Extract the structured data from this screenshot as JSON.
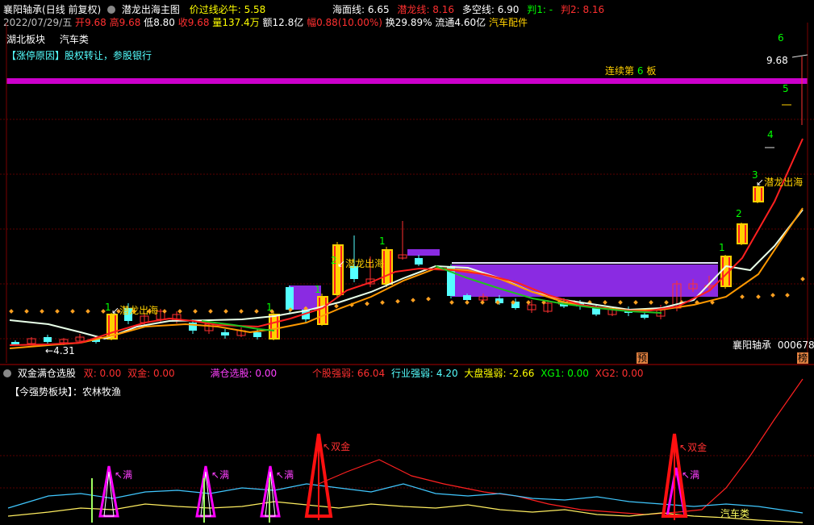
{
  "header": {
    "stock_name": "襄阳轴承",
    "period": "(日线 前复权)",
    "indicator": "潜龙出海主图",
    "price_line_label": "价过线必牛",
    "price_line_value": "5.58",
    "sea_label": "海面线",
    "sea_value": "6.65",
    "dragon_label": "潜龙线",
    "dragon_value": "8.16",
    "bull_label": "多空线",
    "bull_value": "6.90",
    "judge1_label": "判1",
    "judge1_value": "-",
    "judge2_label": "判2",
    "judge2_value": "8.16"
  },
  "quote": {
    "date": "2022/07/29/五",
    "open_label": "开",
    "open": "9.68",
    "high_label": "高",
    "high": "9.68",
    "low_label": "低",
    "low": "8.80",
    "close_label": "收",
    "close": "9.68",
    "vol_label": "量",
    "vol": "137.4万",
    "amt_label": "额",
    "amt": "12.8亿",
    "chg_label": "幅",
    "chg": "0.88(10.00%)",
    "turnover_label": "换",
    "turnover": "29.89%",
    "float_label": "流通",
    "float": "4.60亿",
    "industry": "汽车配件"
  },
  "tags": {
    "region": "湖北板块",
    "sector": "汽车类",
    "reason": "【涨停原因】股权转让，参股银行",
    "streak_prefix": "连续第",
    "streak_num": "6",
    "streak_suffix": "板"
  },
  "price_labels": {
    "max_price": "9.68",
    "min_price": "4.31",
    "stock_label": "襄阳轴承",
    "code": "000678",
    "yu": "预",
    "bang": "榜",
    "signal_text": "潜龙出海"
  },
  "sub": {
    "title": "双金满仓选股",
    "shuang_label": "双",
    "shuang": "0.00",
    "shuangjin_label": "双金",
    "shuangjin": "0.00",
    "manxuan_label": "满仓选股",
    "manxuan": "0.00",
    "gegu_label": "个股强弱",
    "gegu": "66.04",
    "hangye_label": "行业强弱",
    "hangye": "4.20",
    "dapan_label": "大盘强弱",
    "dapan": "-2.66",
    "xg1_label": "XG1",
    "xg1": "0.00",
    "xg2_label": "XG2",
    "xg2": "0.00",
    "strong_sector": "【今强势板块】：农林牧渔",
    "man": "满",
    "shuangjin_mark": "双金",
    "sector_tag": "汽车类"
  },
  "colors": {
    "up": "#ff3030",
    "down": "#54ffff",
    "yellow": "#ffd000",
    "purple": "#b040ff",
    "magenta": "#cc00cc",
    "green": "#00cc00"
  }
}
